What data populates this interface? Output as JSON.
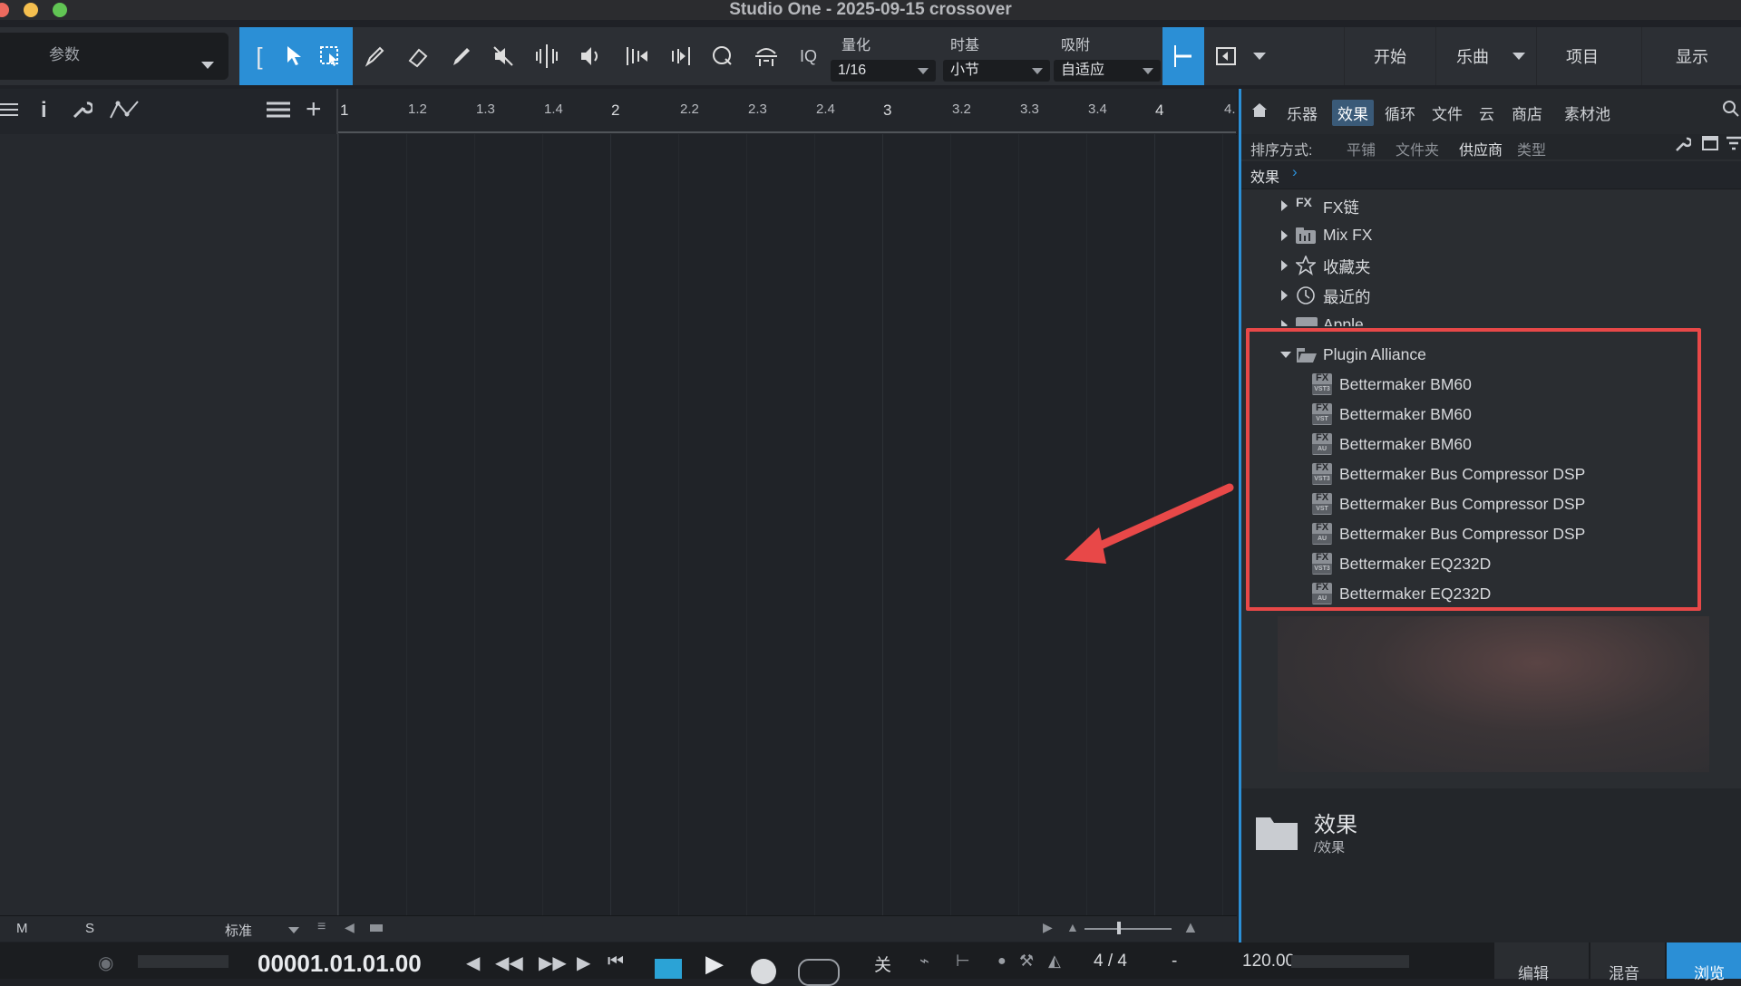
{
  "window": {
    "title": "Studio One - 2025-09-15 crossover"
  },
  "toolbar": {
    "param_label": "参数",
    "quantize_label": "量化",
    "quantize_value": "1/16",
    "timebase_label": "时基",
    "timebase_value": "小节",
    "snap_label": "吸附",
    "snap_value": "自适应",
    "iq_label": "IQ",
    "nav": [
      "开始",
      "乐曲",
      "项目",
      "显示"
    ]
  },
  "ruler": {
    "labels": [
      "1",
      "1.2",
      "1.3",
      "1.4",
      "2",
      "2.2",
      "2.3",
      "2.4",
      "3",
      "3.2",
      "3.3",
      "3.4",
      "4",
      "4."
    ]
  },
  "browser": {
    "tabs": [
      "乐器",
      "效果",
      "循环",
      "文件",
      "云",
      "商店",
      "素材池"
    ],
    "active_tab": "效果",
    "sort_label": "排序方式:",
    "sort_options": [
      "平铺",
      "文件夹",
      "供应商",
      "类型"
    ],
    "sort_selected": "供应商",
    "breadcrumb": "效果",
    "tree": [
      {
        "label": "FX链",
        "icon": "fx-chain-icon"
      },
      {
        "label": "Mix FX",
        "icon": "mixfx-icon"
      },
      {
        "label": "收藏夹",
        "icon": "star-icon"
      },
      {
        "label": "最近的",
        "icon": "clock-icon"
      },
      {
        "label": "Apple",
        "icon": "folder-icon"
      },
      {
        "label": "Plugin Alliance",
        "icon": "folder-open-icon"
      }
    ],
    "plugins": [
      {
        "label": "Bettermaker BM60",
        "format": "VST3"
      },
      {
        "label": "Bettermaker BM60",
        "format": "VST"
      },
      {
        "label": "Bettermaker BM60",
        "format": "AU"
      },
      {
        "label": "Bettermaker Bus Compressor DSP",
        "format": "VST3"
      },
      {
        "label": "Bettermaker Bus Compressor DSP",
        "format": "VST"
      },
      {
        "label": "Bettermaker Bus Compressor DSP",
        "format": "AU"
      },
      {
        "label": "Bettermaker EQ232D",
        "format": "VST3"
      },
      {
        "label": "Bettermaker EQ232D",
        "format": "AU"
      }
    ],
    "info_title": "效果",
    "info_path": "/效果"
  },
  "bottombar": {
    "m": "M",
    "s": "S",
    "mode": "标准"
  },
  "transport": {
    "time": "00001.01.01.00",
    "off_label": "关",
    "signature": "4 / 4",
    "dash": "-",
    "tempo": "120.00",
    "right_tabs": [
      "编辑",
      "混音",
      "浏览"
    ]
  },
  "colors": {
    "accent": "#2b8fd6",
    "highlight": "#e84848"
  }
}
